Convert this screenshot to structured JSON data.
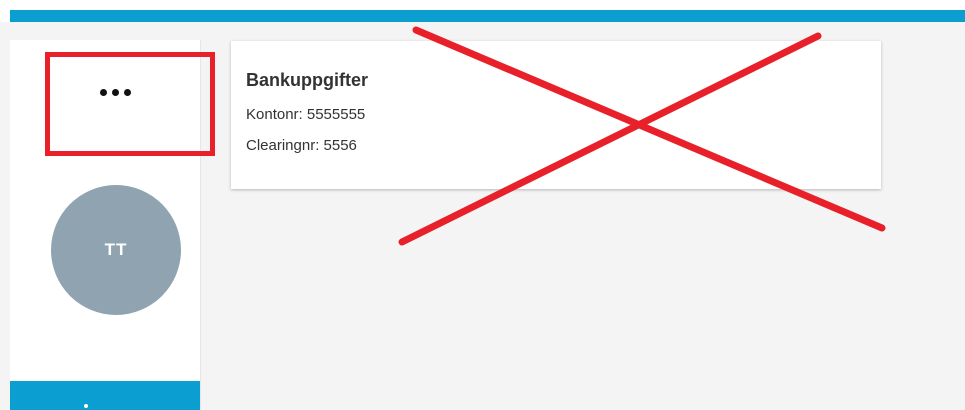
{
  "colors": {
    "accent": "#0a9fd0",
    "avatar_bg": "#8fa4b0",
    "highlight": "#e8202a",
    "cross": "#e8202a"
  },
  "sidebar": {
    "more_icon": "more-horizontal-icon",
    "avatar_initials": "TT"
  },
  "card": {
    "title": "Bankuppgifter",
    "account": "Kontonr: 5555555",
    "clearing": "Clearingnr: 5556"
  }
}
